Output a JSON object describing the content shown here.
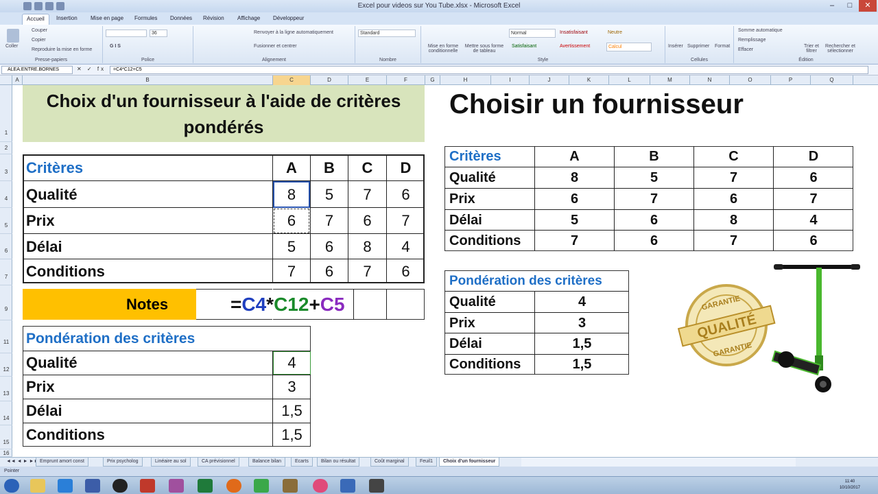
{
  "window": {
    "title": "Excel pour videos sur You Tube.xlsx - Microsoft Excel"
  },
  "menu": {
    "tabs": [
      "Accueil",
      "Insertion",
      "Mise en page",
      "Formules",
      "Données",
      "Révision",
      "Affichage",
      "Développeur"
    ]
  },
  "ribbon": {
    "clipboard": {
      "paste": "Coller",
      "cut": "Couper",
      "copy": "Copier",
      "format_painter": "Reproduire la mise en forme",
      "label": "Presse-papiers"
    },
    "font": {
      "size": "36",
      "label": "Police"
    },
    "alignment": {
      "wrap": "Renvoyer à la ligne automatiquement",
      "merge": "Fusionner et centrer",
      "label": "Alignement"
    },
    "number": {
      "format": "Standard",
      "label": "Nombre"
    },
    "styles": {
      "conditional": "Mise en forme conditionnelle",
      "as_table": "Mettre sous forme de tableau",
      "normal": "Normal",
      "insatisfaisant": "Insatisfaisant",
      "neutre": "Neutre",
      "satisfaisant": "Satisfaisant",
      "avertissement": "Avertissement",
      "calcul": "Calcul",
      "label": "Style"
    },
    "cells": {
      "insert": "Insérer",
      "delete": "Supprimer",
      "format": "Format",
      "label": "Cellules"
    },
    "editing": {
      "autosum": "Somme automatique",
      "fill": "Remplissage",
      "clear": "Effacer",
      "sort": "Trier et filtrer",
      "find": "Rechercher et sélectionner",
      "label": "Édition"
    }
  },
  "formula_bar": {
    "name_box": "ALEA.ENTRE.BORNES",
    "fx": "✕ ✓ fx",
    "formula": "=C4*C12+C5"
  },
  "columns": [
    "A",
    "B",
    "C",
    "D",
    "E",
    "F",
    "G",
    "H",
    "I",
    "J",
    "K",
    "L",
    "M",
    "N",
    "O",
    "P",
    "Q"
  ],
  "rows": [
    "1",
    "2",
    "3",
    "4",
    "5",
    "6",
    "7",
    "9",
    "11",
    "12",
    "13",
    "14",
    "15",
    "16"
  ],
  "left": {
    "title": "Choix d'un fournisseur à l'aide de critères pondérés",
    "header": [
      "Critères",
      "A",
      "B",
      "C",
      "D"
    ],
    "rows": [
      [
        "Qualité",
        "8",
        "5",
        "7",
        "6"
      ],
      [
        "Prix",
        "6",
        "7",
        "6",
        "7"
      ],
      [
        "Délai",
        "5",
        "6",
        "8",
        "4"
      ],
      [
        "Conditions",
        "7",
        "6",
        "7",
        "6"
      ]
    ],
    "notes_label": "Notes",
    "formula": {
      "eq": "=",
      "p1": "C4",
      "op1": "*",
      "p2": "C12",
      "op2": "+",
      "p3": "C5"
    },
    "weights_title": "Pondération des critères",
    "weights": [
      [
        "Qualité",
        "4"
      ],
      [
        "Prix",
        "3"
      ],
      [
        "Délai",
        "1,5"
      ],
      [
        "Conditions",
        "1,5"
      ]
    ]
  },
  "right": {
    "title": "Choisir un fournisseur",
    "header": [
      "Critères",
      "A",
      "B",
      "C",
      "D"
    ],
    "rows": [
      [
        "Qualité",
        "8",
        "5",
        "7",
        "6"
      ],
      [
        "Prix",
        "6",
        "7",
        "6",
        "7"
      ],
      [
        "Délai",
        "5",
        "6",
        "8",
        "4"
      ],
      [
        "Conditions",
        "7",
        "6",
        "7",
        "6"
      ]
    ],
    "weights_title": "Pondération des critères",
    "weights": [
      [
        "Qualité",
        "4"
      ],
      [
        "Prix",
        "3"
      ],
      [
        "Délai",
        "1,5"
      ],
      [
        "Conditions",
        "1,5"
      ]
    ]
  },
  "seal": {
    "top": "GARANTIE",
    "mid": "QUALITÉ",
    "bottom": "GARANTIE"
  },
  "sheet_tabs": [
    "Emprunt amort const",
    "Prix psycholog",
    "Linéaire au sol",
    "CA prévisionnel",
    "Balance bilan",
    "Ecarts",
    "Bilan ou résultat",
    "Coût marginal",
    "Feuil1",
    "Choix d'un fournisseur"
  ],
  "status": {
    "mode": "Pointer"
  },
  "clock": {
    "time": "11:40",
    "date": "10/10/2017"
  },
  "colors": {
    "accent_title_bg": "#d8e4bc",
    "notes_bg": "#ffc000",
    "blue": "#1f6fc6",
    "green": "#1a8a2a",
    "purple": "#8a2bbf"
  }
}
